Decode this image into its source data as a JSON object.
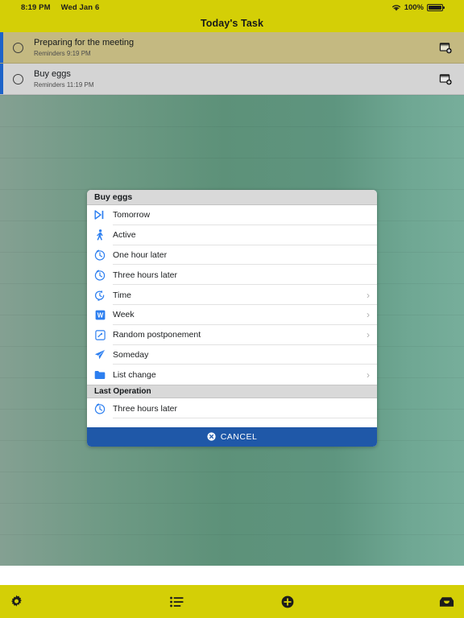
{
  "statusbar": {
    "time": "8:19 PM",
    "date": "Wed Jan 6",
    "battery_percent": "100%",
    "wifi_icon": "wifi-icon",
    "battery_icon": "battery-full-icon"
  },
  "header": {
    "title": "Today's Task",
    "bar_color": "#d4cf06"
  },
  "tasks": [
    {
      "title": "Preparing for the meeting",
      "subtitle": "Reminders 9:19 PM",
      "selected": true,
      "row_color": "#c4b981",
      "accent_color": "#1d63c9",
      "checkbox_icon": "circle-unchecked-icon",
      "action_icon": "archive-badge-icon"
    },
    {
      "title": "Buy eggs",
      "subtitle": "Reminders 11:19 PM",
      "selected": false,
      "row_color": "#d4d4d4",
      "accent_color": "#1d63c9",
      "checkbox_icon": "circle-unchecked-icon",
      "action_icon": "archive-badge-icon"
    }
  ],
  "dialog": {
    "title": "Buy eggs",
    "accent_color": "#2d7ff0",
    "items": [
      {
        "label": "Tomorrow",
        "icon": "skip-forward-icon",
        "chevron": false
      },
      {
        "label": "Active",
        "icon": "person-walking-icon",
        "chevron": false
      },
      {
        "label": "One hour later",
        "icon": "clock-icon",
        "chevron": false
      },
      {
        "label": "Three hours later",
        "icon": "clock-icon",
        "chevron": false
      },
      {
        "label": "Time",
        "icon": "clock-arrow-icon",
        "chevron": true
      },
      {
        "label": "Week",
        "icon": "week-calendar-icon",
        "chevron": true
      },
      {
        "label": "Random postponement",
        "icon": "random-box-icon",
        "chevron": true
      },
      {
        "label": "Someday",
        "icon": "paper-plane-icon",
        "chevron": false
      },
      {
        "label": "List change",
        "icon": "folder-icon",
        "chevron": true
      }
    ],
    "section_title": "Last Operation",
    "last_operation": {
      "label": "Three hours later",
      "icon": "clock-icon",
      "chevron": false
    },
    "cancel_label": "CANCEL",
    "cancel_icon": "close-circle-icon",
    "cancel_color": "#1f58a8"
  },
  "toolbar": {
    "bar_color": "#d4cf06",
    "items": [
      {
        "name": "settings",
        "icon": "gear-icon"
      },
      {
        "name": "lists",
        "icon": "list-icon"
      },
      {
        "name": "add-task",
        "icon": "plus-circle-icon"
      },
      {
        "name": "inbox",
        "icon": "inbox-icon"
      }
    ]
  }
}
